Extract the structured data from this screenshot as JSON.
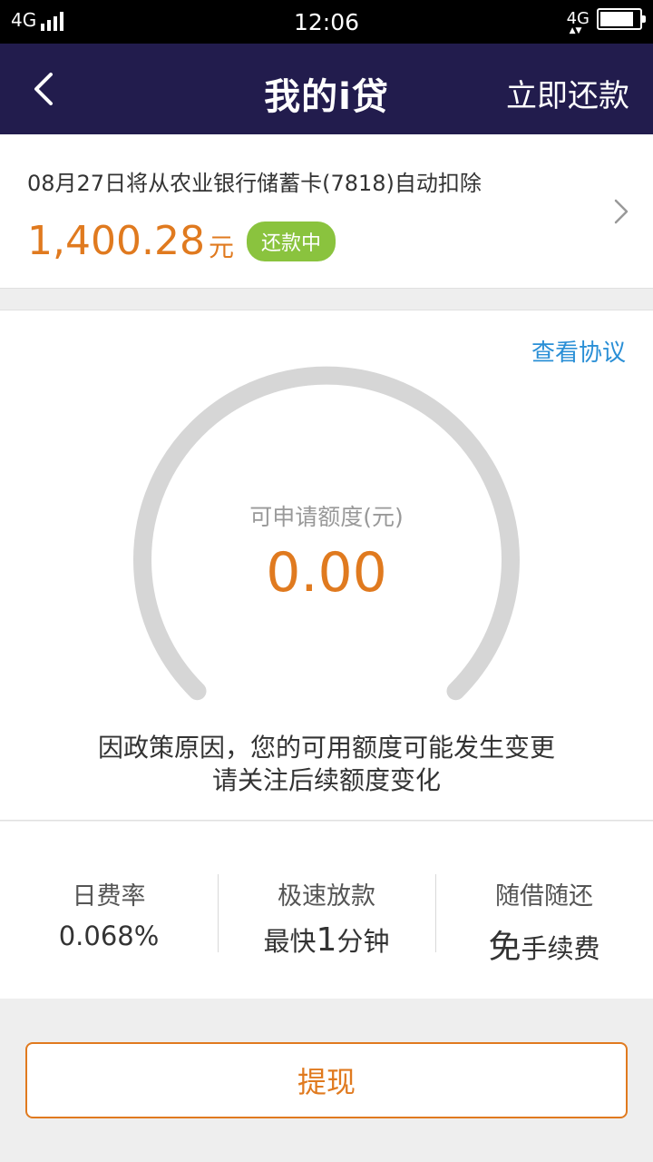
{
  "status_bar": {
    "network_left": "4G",
    "time": "12:06",
    "network_right": "4G",
    "battery_level": 0.85
  },
  "header": {
    "title": "我的i贷",
    "action": "立即还款",
    "back_icon": "chevron-left-icon",
    "background": "#221c4d"
  },
  "repayment": {
    "description": "08月27日将从农业银行储蓄卡(7818)自动扣除",
    "amount": "1,400.28",
    "unit": "元",
    "status": "还款中",
    "chevron_icon": "chevron-right-icon"
  },
  "credit": {
    "view_agreement": "查看协议",
    "label": "可申请额度(元)",
    "value": "0.00",
    "gauge_fill": 0,
    "notice_line1": "因政策原因，您的可用额度可能发生变更",
    "notice_line2": "请关注后续额度变化"
  },
  "features": [
    {
      "title": "日费率",
      "value": "0.068%"
    },
    {
      "title": "极速放款",
      "prefix": "最快",
      "big": "1",
      "suffix": "分钟"
    },
    {
      "title": "随借随还",
      "prefix": "",
      "big": "免",
      "suffix": "手续费"
    }
  ],
  "withdraw_button": "提现",
  "colors": {
    "accent": "#e07a1f",
    "badge": "#8ac33e",
    "link": "#2a8fd6"
  }
}
